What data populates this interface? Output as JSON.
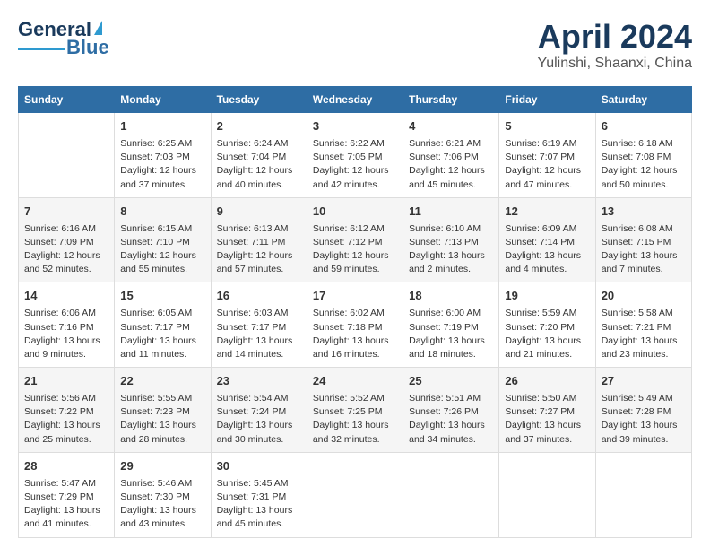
{
  "header": {
    "logo_general": "General",
    "logo_blue": "Blue",
    "title": "April 2024",
    "subtitle": "Yulinshi, Shaanxi, China"
  },
  "days_of_week": [
    "Sunday",
    "Monday",
    "Tuesday",
    "Wednesday",
    "Thursday",
    "Friday",
    "Saturday"
  ],
  "weeks": [
    {
      "cells": [
        {
          "day": "",
          "info": ""
        },
        {
          "day": "1",
          "info": "Sunrise: 6:25 AM\nSunset: 7:03 PM\nDaylight: 12 hours\nand 37 minutes."
        },
        {
          "day": "2",
          "info": "Sunrise: 6:24 AM\nSunset: 7:04 PM\nDaylight: 12 hours\nand 40 minutes."
        },
        {
          "day": "3",
          "info": "Sunrise: 6:22 AM\nSunset: 7:05 PM\nDaylight: 12 hours\nand 42 minutes."
        },
        {
          "day": "4",
          "info": "Sunrise: 6:21 AM\nSunset: 7:06 PM\nDaylight: 12 hours\nand 45 minutes."
        },
        {
          "day": "5",
          "info": "Sunrise: 6:19 AM\nSunset: 7:07 PM\nDaylight: 12 hours\nand 47 minutes."
        },
        {
          "day": "6",
          "info": "Sunrise: 6:18 AM\nSunset: 7:08 PM\nDaylight: 12 hours\nand 50 minutes."
        }
      ]
    },
    {
      "cells": [
        {
          "day": "7",
          "info": "Sunrise: 6:16 AM\nSunset: 7:09 PM\nDaylight: 12 hours\nand 52 minutes."
        },
        {
          "day": "8",
          "info": "Sunrise: 6:15 AM\nSunset: 7:10 PM\nDaylight: 12 hours\nand 55 minutes."
        },
        {
          "day": "9",
          "info": "Sunrise: 6:13 AM\nSunset: 7:11 PM\nDaylight: 12 hours\nand 57 minutes."
        },
        {
          "day": "10",
          "info": "Sunrise: 6:12 AM\nSunset: 7:12 PM\nDaylight: 12 hours\nand 59 minutes."
        },
        {
          "day": "11",
          "info": "Sunrise: 6:10 AM\nSunset: 7:13 PM\nDaylight: 13 hours\nand 2 minutes."
        },
        {
          "day": "12",
          "info": "Sunrise: 6:09 AM\nSunset: 7:14 PM\nDaylight: 13 hours\nand 4 minutes."
        },
        {
          "day": "13",
          "info": "Sunrise: 6:08 AM\nSunset: 7:15 PM\nDaylight: 13 hours\nand 7 minutes."
        }
      ]
    },
    {
      "cells": [
        {
          "day": "14",
          "info": "Sunrise: 6:06 AM\nSunset: 7:16 PM\nDaylight: 13 hours\nand 9 minutes."
        },
        {
          "day": "15",
          "info": "Sunrise: 6:05 AM\nSunset: 7:17 PM\nDaylight: 13 hours\nand 11 minutes."
        },
        {
          "day": "16",
          "info": "Sunrise: 6:03 AM\nSunset: 7:17 PM\nDaylight: 13 hours\nand 14 minutes."
        },
        {
          "day": "17",
          "info": "Sunrise: 6:02 AM\nSunset: 7:18 PM\nDaylight: 13 hours\nand 16 minutes."
        },
        {
          "day": "18",
          "info": "Sunrise: 6:00 AM\nSunset: 7:19 PM\nDaylight: 13 hours\nand 18 minutes."
        },
        {
          "day": "19",
          "info": "Sunrise: 5:59 AM\nSunset: 7:20 PM\nDaylight: 13 hours\nand 21 minutes."
        },
        {
          "day": "20",
          "info": "Sunrise: 5:58 AM\nSunset: 7:21 PM\nDaylight: 13 hours\nand 23 minutes."
        }
      ]
    },
    {
      "cells": [
        {
          "day": "21",
          "info": "Sunrise: 5:56 AM\nSunset: 7:22 PM\nDaylight: 13 hours\nand 25 minutes."
        },
        {
          "day": "22",
          "info": "Sunrise: 5:55 AM\nSunset: 7:23 PM\nDaylight: 13 hours\nand 28 minutes."
        },
        {
          "day": "23",
          "info": "Sunrise: 5:54 AM\nSunset: 7:24 PM\nDaylight: 13 hours\nand 30 minutes."
        },
        {
          "day": "24",
          "info": "Sunrise: 5:52 AM\nSunset: 7:25 PM\nDaylight: 13 hours\nand 32 minutes."
        },
        {
          "day": "25",
          "info": "Sunrise: 5:51 AM\nSunset: 7:26 PM\nDaylight: 13 hours\nand 34 minutes."
        },
        {
          "day": "26",
          "info": "Sunrise: 5:50 AM\nSunset: 7:27 PM\nDaylight: 13 hours\nand 37 minutes."
        },
        {
          "day": "27",
          "info": "Sunrise: 5:49 AM\nSunset: 7:28 PM\nDaylight: 13 hours\nand 39 minutes."
        }
      ]
    },
    {
      "cells": [
        {
          "day": "28",
          "info": "Sunrise: 5:47 AM\nSunset: 7:29 PM\nDaylight: 13 hours\nand 41 minutes."
        },
        {
          "day": "29",
          "info": "Sunrise: 5:46 AM\nSunset: 7:30 PM\nDaylight: 13 hours\nand 43 minutes."
        },
        {
          "day": "30",
          "info": "Sunrise: 5:45 AM\nSunset: 7:31 PM\nDaylight: 13 hours\nand 45 minutes."
        },
        {
          "day": "",
          "info": ""
        },
        {
          "day": "",
          "info": ""
        },
        {
          "day": "",
          "info": ""
        },
        {
          "day": "",
          "info": ""
        }
      ]
    }
  ]
}
